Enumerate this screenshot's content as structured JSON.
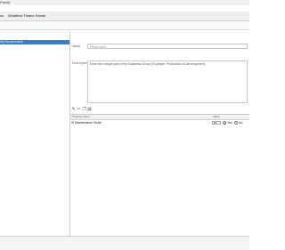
{
  "window": {
    "title": "Panel]"
  },
  "menu": {
    "items": [
      {
        "label": "ns"
      },
      {
        "label": "Workflow Timers"
      },
      {
        "label": "Exede"
      }
    ]
  },
  "tree": {
    "selected_item": "nry Environment"
  },
  "form": {
    "name_label": "Name",
    "name_value": "string name",
    "description_label": "Description",
    "description_value": "Enter the unique part of the Business Group (Example: Production or Development)"
  },
  "toolbar": {
    "icons": [
      "add-icon",
      "cut-icon",
      "copy-icon",
      "paste-icon"
    ]
  },
  "grid": {
    "headers": {
      "name": "Property name",
      "value": "Value"
    },
    "rows": [
      {
        "name": "Maintenance Mode",
        "combo_value": "Bit",
        "options": [
          {
            "label": "Yes",
            "selected": true
          },
          {
            "label": "No",
            "selected": false
          }
        ]
      }
    ]
  }
}
